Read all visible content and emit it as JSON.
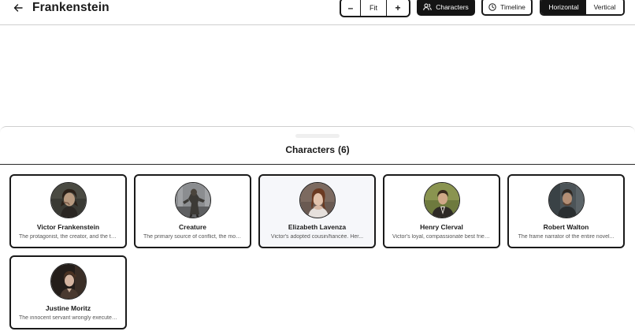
{
  "header": {
    "title": "Frankenstein",
    "zoom": {
      "minus_label": "–",
      "fit_label": "Fit",
      "plus_label": "+"
    },
    "characters_label": "Characters",
    "timeline_label": "Timeline",
    "orientation": {
      "horizontal_label": "Horizontal",
      "vertical_label": "Vertical",
      "selected": "Horizontal"
    }
  },
  "panel": {
    "title": "Characters",
    "count": "(6)"
  },
  "characters": [
    {
      "name": "Victor Frankenstein",
      "description": "The protagonist, the creator, and the tragic..."
    },
    {
      "name": "Creature",
      "description": "The primary source of conflict, the monster..."
    },
    {
      "name": "Elizabeth Lavenza",
      "description": "Victor's adopted cousin/fiancée. Her..."
    },
    {
      "name": "Henry Clerval",
      "description": "Victor's loyal, compassionate best friend..."
    },
    {
      "name": "Robert Walton",
      "description": "The frame narrator of the entire novel..."
    },
    {
      "name": "Justine Moritz",
      "description": "The innocent servant wrongly executed..."
    }
  ],
  "colors": {
    "primary": "#141414",
    "border": "#1a1a1a",
    "highlight_card": "#f6f7fa"
  }
}
